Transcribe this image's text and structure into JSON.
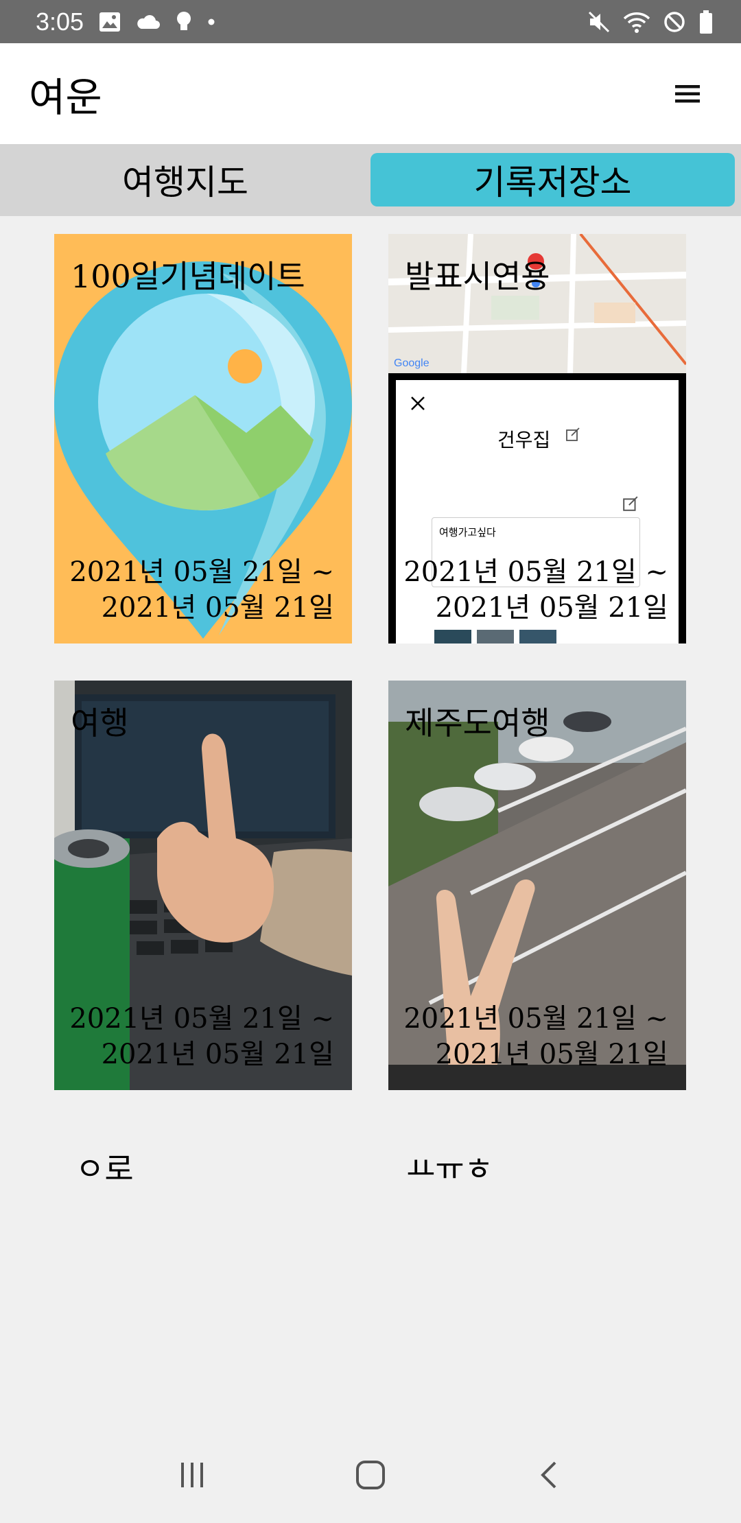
{
  "status_bar": {
    "time": "3:05",
    "left_icons": [
      "image-icon",
      "cloud-icon",
      "bulb-icon",
      "dot-icon"
    ],
    "right_icons": [
      "mute-icon",
      "wifi-icon",
      "block-icon",
      "battery-icon"
    ]
  },
  "app_bar": {
    "title": "여운",
    "menu_icon": "hamburger-menu-icon"
  },
  "tabs": [
    {
      "label": "여행지도",
      "selected": false
    },
    {
      "label": "기록저장소",
      "selected": true
    }
  ],
  "colors": {
    "status_bar": "#6b6b6b",
    "tab_active": "#45c3d6",
    "tab_bar": "#d4d4d4",
    "background": "#f0f0f0",
    "placeholder_bg": "#ffbc57"
  },
  "cards": [
    {
      "title": "100일기념데이트",
      "date_start": "2021년 05월 21일 ~",
      "date_end": "2021년 05월 21일",
      "image": "placeholder-image-icon"
    },
    {
      "title": "발표시연용",
      "date_start": "2021년 05월 21일 ~",
      "date_end": "2021년 05월 21일",
      "image": "map-screenshot",
      "thumb": {
        "dialog_title": "건우집",
        "memo": "여행가고싶다"
      }
    },
    {
      "title": "여행",
      "date_start": "2021년 05월 21일 ~",
      "date_end": "2021년 05월 21일",
      "image": "thumbs-up-photo"
    },
    {
      "title": "제주도여행",
      "date_start": "2021년 05월 21일 ~",
      "date_end": "2021년 05월 21일",
      "image": "parking-lot-photo"
    }
  ],
  "captions": [
    "ㅇ로",
    "ㅛㅠㅎ"
  ],
  "nav_bar": [
    "recent-apps-icon",
    "home-icon",
    "back-icon"
  ]
}
